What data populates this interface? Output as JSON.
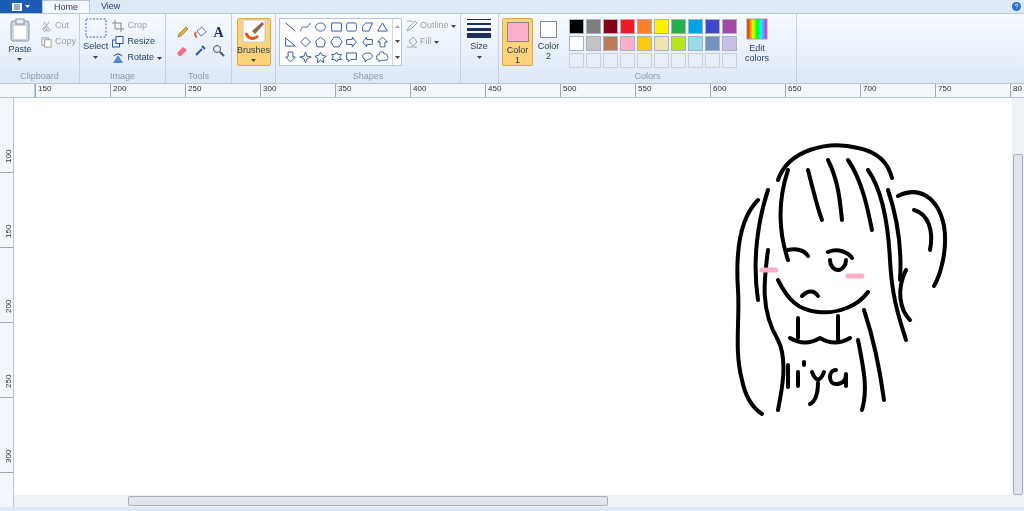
{
  "tabs": [
    {
      "label": "Home",
      "selected": true
    },
    {
      "label": "View",
      "selected": false
    }
  ],
  "clipboard": {
    "label": "Clipboard",
    "paste": "Paste",
    "items": [
      {
        "label": "Cut",
        "disabled": true
      },
      {
        "label": "Copy",
        "disabled": true
      }
    ]
  },
  "image": {
    "label": "Image",
    "select": "Select",
    "items": [
      {
        "label": "Crop",
        "disabled": true
      },
      {
        "label": "Resize",
        "disabled": false
      },
      {
        "label": "Rotate",
        "disabled": false
      }
    ]
  },
  "tools": {
    "label": "Tools",
    "text_tool": "A"
  },
  "brushes": {
    "label": "Brushes",
    "selected": true
  },
  "shapes": {
    "label": "Shapes",
    "outline": {
      "label": "Outline",
      "disabled": true
    },
    "fill": {
      "label": "Fill",
      "disabled": true
    }
  },
  "size": {
    "label": "Size"
  },
  "colors": {
    "label": "Colors",
    "current": [
      {
        "label": "Color",
        "number": "1",
        "color": "#ffaec9",
        "selected": true
      },
      {
        "label": "Color",
        "number": "2",
        "color": "#ffffff",
        "selected": false
      }
    ],
    "palette": [
      {
        "color": "#000000"
      },
      {
        "color": "#7f7f7f"
      },
      {
        "color": "#880015"
      },
      {
        "color": "#ed1c24"
      },
      {
        "color": "#ff7f27"
      },
      {
        "color": "#fff200"
      },
      {
        "color": "#22b14c"
      },
      {
        "color": "#00a2e8"
      },
      {
        "color": "#3f48cc"
      },
      {
        "color": "#a349a4"
      },
      {
        "color": "#ffffff"
      },
      {
        "color": "#c3c3c3"
      },
      {
        "color": "#b97a57"
      },
      {
        "color": "#ffaec9"
      },
      {
        "color": "#ffc90e"
      },
      {
        "color": "#efe4b0"
      },
      {
        "color": "#b5e61d"
      },
      {
        "color": "#99d9ea"
      },
      {
        "color": "#7092be"
      },
      {
        "color": "#c8bfe7"
      }
    ],
    "edit": "Edit colors"
  },
  "rulers": {
    "horizontal": [
      "150",
      "200",
      "250",
      "300",
      "350",
      "400",
      "450",
      "500",
      "550",
      "600",
      "650",
      "700",
      "750",
      "80"
    ],
    "vertical": [
      "100",
      "150",
      "200",
      "250",
      "300"
    ]
  }
}
